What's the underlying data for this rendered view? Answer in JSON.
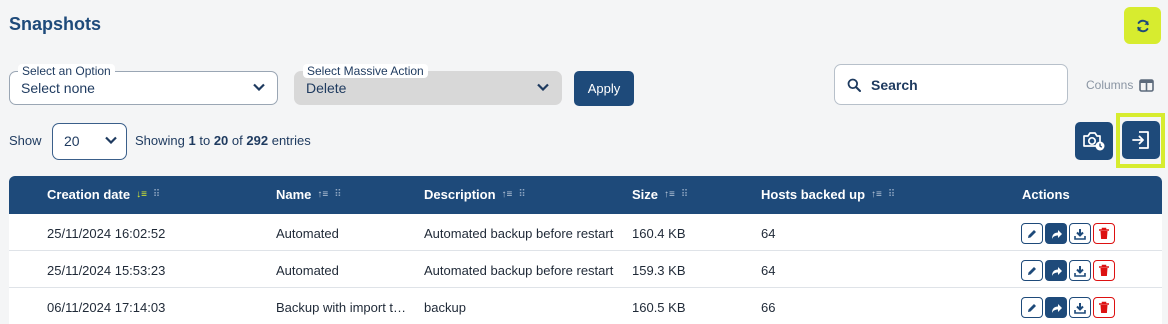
{
  "page": {
    "title": "Snapshots"
  },
  "toolbar": {
    "option_select": {
      "legend": "Select an Option",
      "value": "Select none"
    },
    "massive_select": {
      "legend": "Select Massive Action",
      "value": "Delete"
    },
    "apply_label": "Apply",
    "search_placeholder": "Search",
    "columns_label": "Columns"
  },
  "pagination": {
    "show_label": "Show",
    "page_size": "20",
    "info_prefix": "Showing",
    "from": "1",
    "to_word": "to",
    "to": "20",
    "of_word": "of",
    "total": "292",
    "info_suffix": "entries"
  },
  "table": {
    "columns": [
      "Creation date",
      "Name",
      "Description",
      "Size",
      "Hosts backed up",
      "Actions"
    ],
    "rows": [
      {
        "date": "25/11/2024 16:02:52",
        "name": "Automated",
        "description": "Automated backup before restart",
        "size": "160.4 KB",
        "hosts": "64"
      },
      {
        "date": "25/11/2024 15:53:23",
        "name": "Automated",
        "description": "Automated backup before restart",
        "size": "159.3 KB",
        "hosts": "64"
      },
      {
        "date": "06/11/2024 17:14:03",
        "name": "Backup with import t…",
        "description": "backup",
        "size": "160.5 KB",
        "hosts": "66"
      }
    ]
  },
  "icons": {
    "refresh": "refresh-icon",
    "search": "search-icon",
    "columns": "columns-icon",
    "snapshot": "camera-clock-icon",
    "import": "import-icon",
    "edit": "pencil-icon",
    "share": "share-arrow-icon",
    "download": "download-icon",
    "delete": "trash-icon"
  },
  "colors": {
    "primary": "#1e4a7a",
    "accent": "#d7ec2f",
    "danger": "#dd1111"
  }
}
